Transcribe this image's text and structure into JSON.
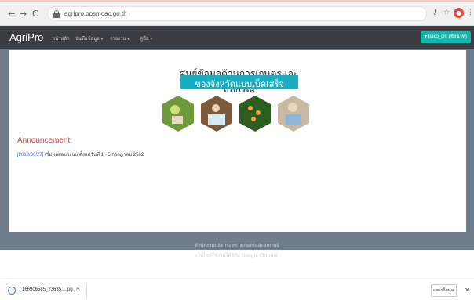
{
  "browser": {
    "url": "agripro.opsmoac.go.th",
    "avatar_initial": "👤"
  },
  "navbar": {
    "brand": "AgriPro",
    "menu": [
      "หน้าหลัก",
      "บันทึกข้อมูล ▾",
      "รายงาน ▾",
      "คู่มือ ▾"
    ],
    "user_button": "▾ paco_cnt (ชัยนาท)"
  },
  "banner": {
    "headline": "ศูนย์ข้อมูลด้านการเกษตรและสหกรณ์",
    "subtitle": "ของจังหวัดแบบเบ็ดเสร็จ"
  },
  "announcement": {
    "title": "Announcement",
    "date": "[2019/06/27]",
    "text": "เริ่มทดสอบระบบ ตั้งแต่วันที่ 1 - 5 กรกฎาคม 2562"
  },
  "footer": {
    "line1": "สำนักงานปลัดกระทรวงเกษตรและสหกรณ์",
    "line2": "เว็บไซต์ใช้งานได้ดีกับ Google Chrome"
  },
  "download": {
    "filename": "166906585_23635....jpg",
    "show_all": "แสดงทั้งหมด"
  },
  "colors": {
    "navbar": "#3b3d42",
    "accent_teal": "#17b6a8",
    "banner_teal": "#1aaec2",
    "announcement_red": "#d33b3b",
    "page_bg": "#6f7d8b"
  }
}
